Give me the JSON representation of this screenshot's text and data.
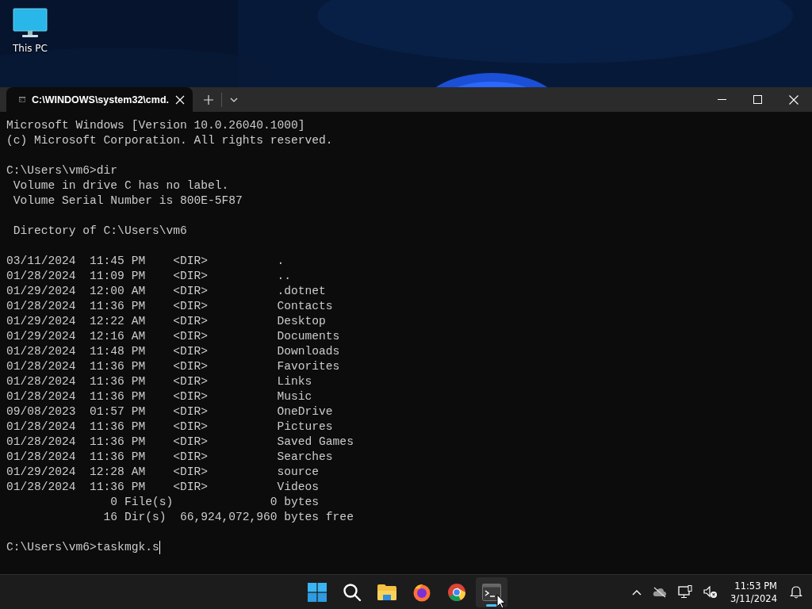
{
  "desktop": {
    "icons": [
      {
        "label": "This PC"
      }
    ]
  },
  "window": {
    "tabs": [
      {
        "title": "C:\\WINDOWS\\system32\\cmd.",
        "selected": true
      }
    ]
  },
  "terminal": {
    "blocks": [
      [
        "Microsoft Windows [Version 10.0.26040.1000]",
        "(c) Microsoft Corporation. All rights reserved."
      ],
      [
        "C:\\Users\\vm6>dir",
        " Volume in drive C has no label.",
        " Volume Serial Number is 800E-5F87"
      ],
      [
        " Directory of C:\\Users\\vm6"
      ],
      [
        "03/11/2024  11:45 PM    <DIR>          .",
        "01/28/2024  11:09 PM    <DIR>          ..",
        "01/29/2024  12:00 AM    <DIR>          .dotnet",
        "01/28/2024  11:36 PM    <DIR>          Contacts",
        "01/29/2024  12:22 AM    <DIR>          Desktop",
        "01/29/2024  12:16 AM    <DIR>          Documents",
        "01/28/2024  11:48 PM    <DIR>          Downloads",
        "01/28/2024  11:36 PM    <DIR>          Favorites",
        "01/28/2024  11:36 PM    <DIR>          Links",
        "01/28/2024  11:36 PM    <DIR>          Music",
        "09/08/2023  01:57 PM    <DIR>          OneDrive",
        "01/28/2024  11:36 PM    <DIR>          Pictures",
        "01/28/2024  11:36 PM    <DIR>          Saved Games",
        "01/28/2024  11:36 PM    <DIR>          Searches",
        "01/29/2024  12:28 AM    <DIR>          source",
        "01/28/2024  11:36 PM    <DIR>          Videos",
        "               0 File(s)              0 bytes",
        "              16 Dir(s)  66,924,072,960 bytes free"
      ],
      [
        "C:\\Users\\vm6>taskmgk.s"
      ]
    ],
    "cursor": true
  },
  "taskbar": {
    "apps": [
      {
        "kind": "start",
        "active": false
      },
      {
        "kind": "search",
        "active": false
      },
      {
        "kind": "explorer",
        "active": false
      },
      {
        "kind": "firefox",
        "active": false
      },
      {
        "kind": "chrome",
        "active": false
      },
      {
        "kind": "terminal",
        "active": true
      }
    ],
    "clock": {
      "time": "11:53 PM",
      "date": "3/11/2024"
    }
  }
}
